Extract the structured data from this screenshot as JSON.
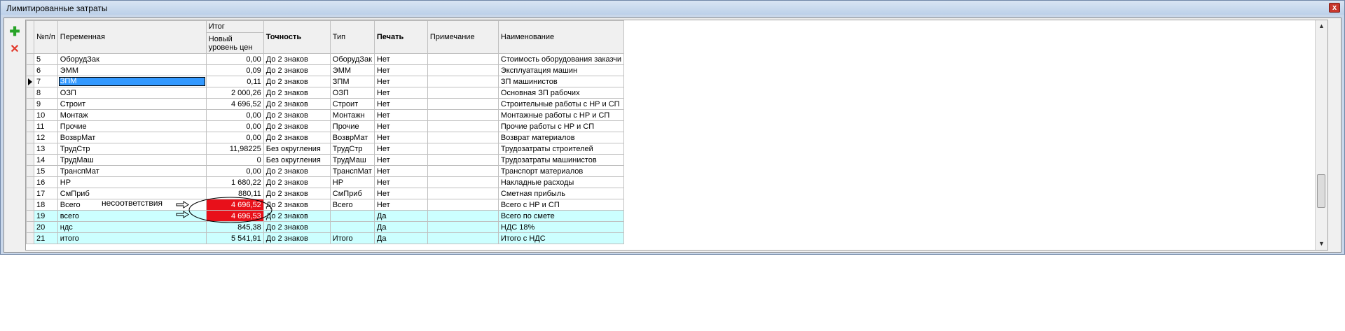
{
  "window": {
    "title": "Лимитированные затраты",
    "close_glyph": "x"
  },
  "toolbar": {
    "add_glyph": "✚",
    "delete_glyph": "✕"
  },
  "headers": {
    "num": "№п/п",
    "variable": "Переменная",
    "itog": "Итог",
    "new_price_line1": "Новый",
    "new_price_line2": "уровень цен",
    "precision": "Точность",
    "type": "Тип",
    "print": "Печать",
    "note": "Примечание",
    "name": "Наименование"
  },
  "rows": [
    {
      "num": "5",
      "variable": "ОборудЗак",
      "value": "0,00",
      "precision": "До 2 знаков",
      "type": "ОборудЗак",
      "print": "Нет",
      "note": "",
      "name": "Стоимость оборудования заказчи"
    },
    {
      "num": "6",
      "variable": "ЭММ",
      "value": "0,09",
      "precision": "До 2 знаков",
      "type": "ЭММ",
      "print": "Нет",
      "note": "",
      "name": "Эксплуатация машин"
    },
    {
      "num": "7",
      "variable": "ЗПМ",
      "value": "0,11",
      "precision": "До 2 знаков",
      "type": "ЗПМ",
      "print": "Нет",
      "note": "",
      "name": "ЗП машинистов"
    },
    {
      "num": "8",
      "variable": "ОЗП",
      "value": "2 000,26",
      "precision": "До 2 знаков",
      "type": "ОЗП",
      "print": "Нет",
      "note": "",
      "name": "Основная ЗП рабочих"
    },
    {
      "num": "9",
      "variable": "Строит",
      "value": "4 696,52",
      "precision": "До 2 знаков",
      "type": "Строит",
      "print": "Нет",
      "note": "",
      "name": "Строительные работы с НР и СП"
    },
    {
      "num": "10",
      "variable": "Монтаж",
      "value": "0,00",
      "precision": "До 2 знаков",
      "type": "Монтажн",
      "print": "Нет",
      "note": "",
      "name": "Монтажные работы с НР и СП"
    },
    {
      "num": "11",
      "variable": "Прочие",
      "value": "0,00",
      "precision": "До 2 знаков",
      "type": "Прочие",
      "print": "Нет",
      "note": "",
      "name": "Прочие работы с НР и СП"
    },
    {
      "num": "12",
      "variable": "ВозврМат",
      "value": "0,00",
      "precision": "До 2 знаков",
      "type": "ВозврМат",
      "print": "Нет",
      "note": "",
      "name": "Возврат материалов"
    },
    {
      "num": "13",
      "variable": "ТрудСтр",
      "value": "11,98225",
      "precision": "Без округления",
      "type": "ТрудСтр",
      "print": "Нет",
      "note": "",
      "name": "Трудозатраты строителей"
    },
    {
      "num": "14",
      "variable": "ТрудМаш",
      "value": "0",
      "precision": "Без округления",
      "type": "ТрудМаш",
      "print": "Нет",
      "note": "",
      "name": "Трудозатраты машинистов"
    },
    {
      "num": "15",
      "variable": "ТранспМат",
      "value": "0,00",
      "precision": "До 2 знаков",
      "type": "ТранспМат",
      "print": "Нет",
      "note": "",
      "name": "Транспорт материалов"
    },
    {
      "num": "16",
      "variable": "НР",
      "value": "1 680,22",
      "precision": "До 2 знаков",
      "type": "НР",
      "print": "Нет",
      "note": "",
      "name": "Накладные расходы"
    },
    {
      "num": "17",
      "variable": "СмПриб",
      "value": "880,11",
      "precision": "До 2 знаков",
      "type": "СмПриб",
      "print": "Нет",
      "note": "",
      "name": "Сметная прибыль"
    },
    {
      "num": "18",
      "variable": "Всего",
      "value": "4 696,52",
      "precision": "До 2 знаков",
      "type": "Всего",
      "print": "Нет",
      "note": "",
      "name": "Всего с НР и СП"
    },
    {
      "num": "19",
      "variable": "всего",
      "value": "4 696,53",
      "precision": "До 2 знаков",
      "type": "",
      "print": "Да",
      "note": "",
      "name": "Всего по смете"
    },
    {
      "num": "20",
      "variable": "ндс",
      "value": "845,38",
      "precision": "До 2 знаков",
      "type": "",
      "print": "Да",
      "note": "",
      "name": "НДС 18%"
    },
    {
      "num": "21",
      "variable": "итого",
      "value": "5 541,91",
      "precision": "До 2 знаков",
      "type": "Итого",
      "print": "Да",
      "note": "",
      "name": "Итого с НДС"
    }
  ],
  "annotation": {
    "label": "несоответствия"
  },
  "colors": {
    "mismatch": "#e8101a",
    "highlight_row": "#ccffff",
    "selection": "#3399ff"
  }
}
